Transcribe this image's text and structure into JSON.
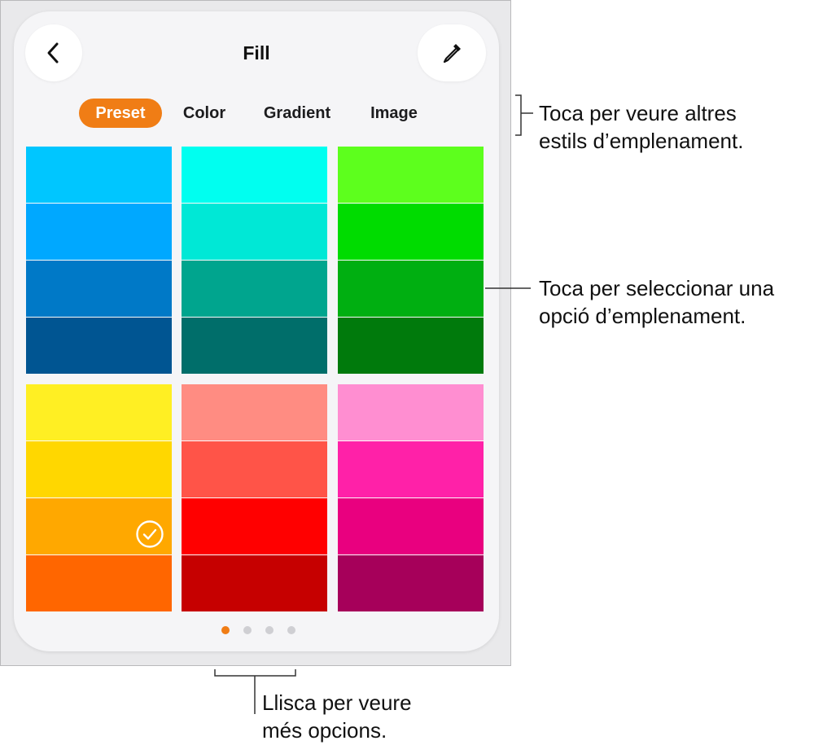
{
  "header": {
    "title": "Fill"
  },
  "tabs": [
    {
      "label": "Preset",
      "active": true
    },
    {
      "label": "Color",
      "active": false
    },
    {
      "label": "Gradient",
      "active": false
    },
    {
      "label": "Image",
      "active": false
    }
  ],
  "swatch_groups": [
    {
      "colors": [
        "#00c6ff",
        "#00a8ff",
        "#0079c7",
        "#005592"
      ],
      "selected": null
    },
    {
      "colors": [
        "#00fff0",
        "#00e8d6",
        "#00a58e",
        "#006e6a"
      ],
      "selected": null
    },
    {
      "colors": [
        "#5dff1d",
        "#00dc00",
        "#00af11",
        "#007a0c"
      ],
      "selected": null
    },
    {
      "colors": [
        "#ffef23",
        "#ffd700",
        "#ffa800",
        "#ff6600"
      ],
      "selected": 2
    },
    {
      "colors": [
        "#ff8c82",
        "#ff5448",
        "#ff0000",
        "#c60000"
      ],
      "selected": null
    },
    {
      "colors": [
        "#ff8ed1",
        "#ff21a8",
        "#e9007f",
        "#a6005a"
      ],
      "selected": null
    }
  ],
  "page_indicator": {
    "count": 4,
    "current": 1
  },
  "callouts": {
    "tabs": [
      "Toca per veure altres",
      "estils d’emplenament."
    ],
    "swatches": [
      "Toca per seleccionar una",
      "opció d’emplenament."
    ],
    "swipe": [
      "Llisca per veure",
      "més opcions."
    ]
  },
  "colors": {
    "accent": "#f07d15",
    "panel_bg": "#f5f5f7",
    "frame_bg": "#e9e9eb"
  }
}
